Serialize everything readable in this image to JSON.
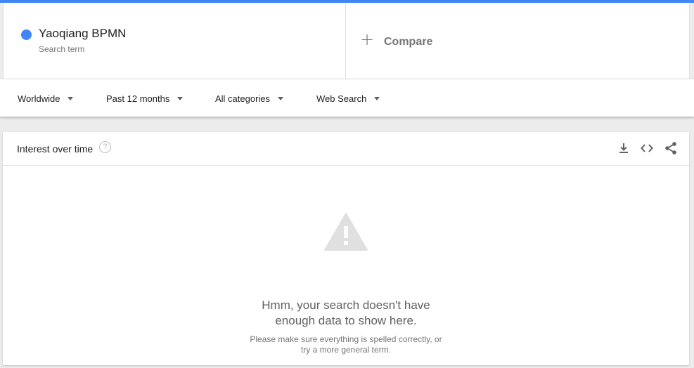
{
  "term": {
    "name": "Yaoqiang BPMN",
    "subtitle": "Search term",
    "color": "#4285f4"
  },
  "compare": {
    "label": "Compare"
  },
  "filters": [
    {
      "label": "Worldwide"
    },
    {
      "label": "Past 12 months"
    },
    {
      "label": "All categories"
    },
    {
      "label": "Web Search"
    }
  ],
  "panel": {
    "title": "Interest over time",
    "help_icon": "help-circle-icon",
    "actions": [
      "download-icon",
      "embed-code-icon",
      "share-icon"
    ]
  },
  "empty_state": {
    "icon": "warning-icon",
    "line1": "Hmm, your search doesn't have",
    "line2": "enough data to show here.",
    "sub1": "Please make sure everything is spelled correctly, or",
    "sub2": "try a more general term."
  },
  "colors": {
    "accent": "#4285f4",
    "icon_gray": "#616161",
    "warning_gray": "#e0e0e0"
  }
}
